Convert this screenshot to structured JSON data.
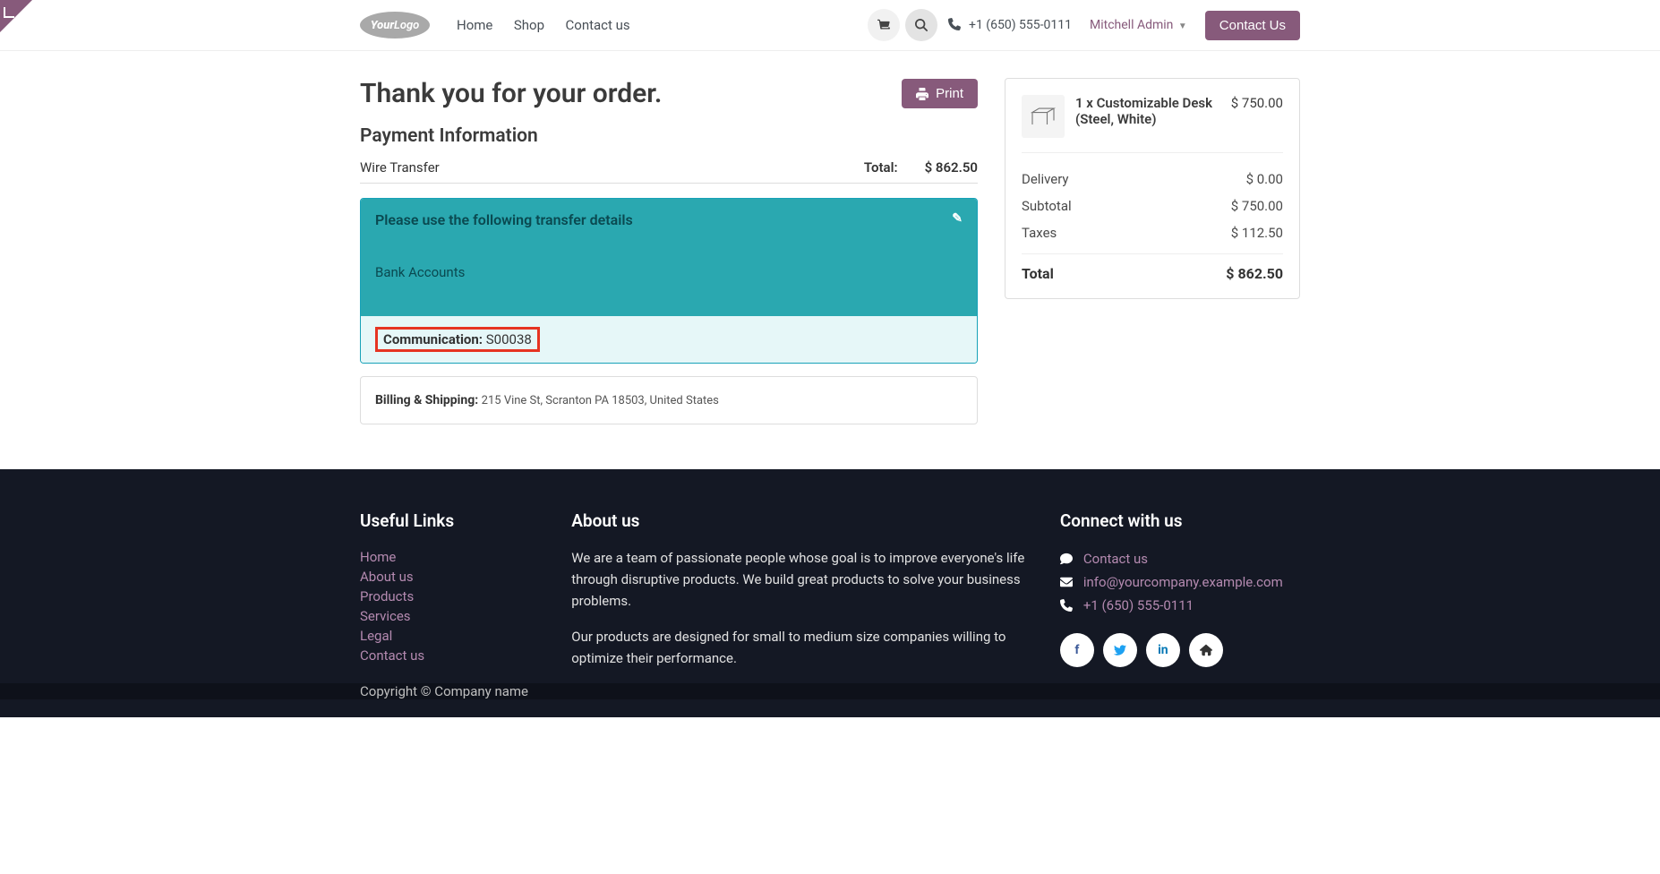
{
  "header": {
    "logo_text_bold": "Your",
    "logo_text_light": "Logo",
    "nav": {
      "home": "Home",
      "shop": "Shop",
      "contact": "Contact us"
    },
    "phone": "+1 (650) 555-0111",
    "user": "Mitchell Admin",
    "contact_btn": "Contact Us"
  },
  "page": {
    "title": "Thank you for your order.",
    "print_btn": "Print",
    "payment_heading": "Payment Information",
    "payment_method": "Wire Transfer",
    "total_label": "Total:",
    "total_amount": "$ 862.50",
    "transfer_title": "Please use the following transfer details",
    "bank_accounts_label": "Bank Accounts",
    "communication_label": "Communication: ",
    "communication_value": "S00038",
    "billing_label": "Billing & Shipping: ",
    "billing_address": "215 Vine St, Scranton PA 18503, United States"
  },
  "summary": {
    "product_name": "1 x Customizable Desk (Steel, White)",
    "product_price": "$ 750.00",
    "lines": [
      {
        "label": "Delivery",
        "value": "$ 0.00"
      },
      {
        "label": "Subtotal",
        "value": "$ 750.00"
      },
      {
        "label": "Taxes",
        "value": "$ 112.50"
      }
    ],
    "total_label": "Total",
    "total_value": "$ 862.50"
  },
  "footer": {
    "useful_heading": "Useful Links",
    "useful_links": [
      "Home",
      "About us",
      "Products",
      "Services",
      "Legal",
      "Contact us"
    ],
    "about_heading": "About us",
    "about_p1": "We are a team of passionate people whose goal is to improve everyone's life through disruptive products. We build great products to solve your business problems.",
    "about_p2": "Our products are designed for small to medium size companies willing to optimize their performance.",
    "connect_heading": "Connect with us",
    "connect_contact": "Contact us",
    "connect_email": "info@yourcompany.example.com",
    "connect_phone": "+1 (650) 555-0111",
    "copyright": "Copyright © Company name"
  }
}
